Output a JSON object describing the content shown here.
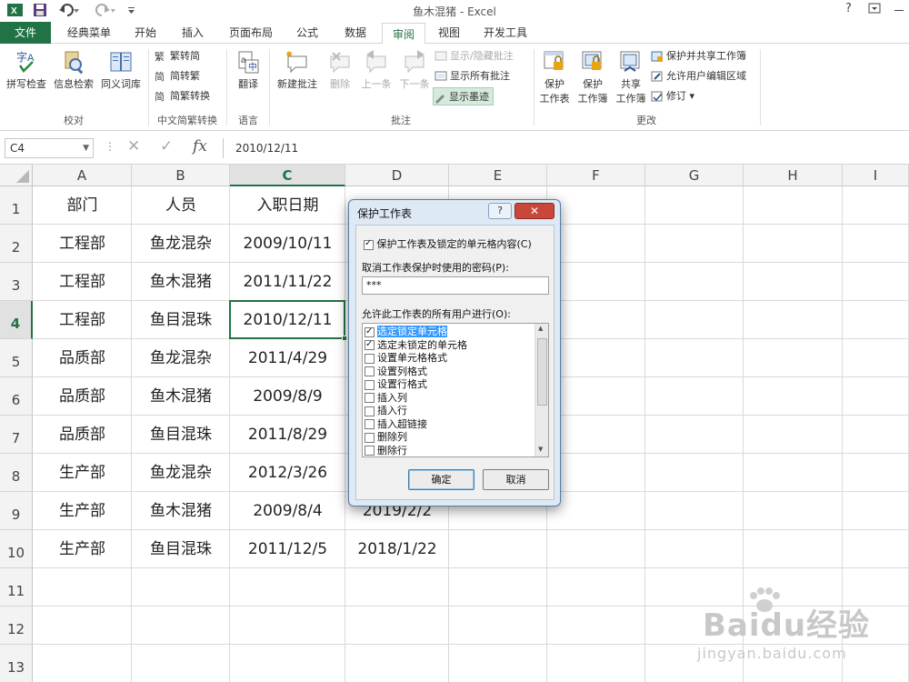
{
  "titlebar": {
    "title": "鱼木混猪 - Excel",
    "qa_icons": [
      "excel-logo-icon",
      "save-icon",
      "undo-icon",
      "redo-icon",
      "customize-icon"
    ],
    "win_icons": [
      "help-icon",
      "ribbon-display-icon",
      "minimize-icon"
    ]
  },
  "tabs": [
    "文件",
    "经典菜单",
    "开始",
    "插入",
    "页面布局",
    "公式",
    "数据",
    "审阅",
    "视图",
    "开发工具"
  ],
  "active_tab": "审阅",
  "ribbon": {
    "proofing": {
      "spell": "拼写检查",
      "research": "信息检索",
      "thesaurus": "同义词库",
      "label": "校对"
    },
    "chinese": {
      "t2s": "繁转简",
      "s2t": "简转繁",
      "convert": "简繁转换",
      "label": "中文简繁转换"
    },
    "language": {
      "translate": "翻译",
      "label": "语言"
    },
    "comments": {
      "new": "新建批注",
      "delete": "删除",
      "prev": "上一条",
      "next": "下一条",
      "show_hide": "显示/隐藏批注",
      "show_all": "显示所有批注",
      "show_ink": "显示墨迹",
      "label": "批注"
    },
    "changes": {
      "protect_sheet_1": "保护",
      "protect_sheet_2": "工作表",
      "protect_book_1": "保护",
      "protect_book_2": "工作簿",
      "share_1": "共享",
      "share_2": "工作簿",
      "protect_share": "保护并共享工作簿",
      "allow_edit": "允许用户编辑区域",
      "track": "修订",
      "label": "更改"
    }
  },
  "formula_bar": {
    "name_box": "C4",
    "formula": "2010/12/11",
    "fx": "fx"
  },
  "columns": [
    "A",
    "B",
    "C",
    "D",
    "E",
    "F",
    "G",
    "H",
    "I"
  ],
  "selected_column": "C",
  "rows": [
    "1",
    "2",
    "3",
    "4",
    "5",
    "6",
    "7",
    "8",
    "9",
    "10",
    "11",
    "12",
    "13"
  ],
  "selected_row": "4",
  "cells": {
    "header": [
      "部门",
      "人员",
      "入职日期"
    ],
    "data": [
      [
        "工程部",
        "鱼龙混杂",
        "2009/10/11"
      ],
      [
        "工程部",
        "鱼木混猪",
        "2011/11/22"
      ],
      [
        "工程部",
        "鱼目混珠",
        "2010/12/11"
      ],
      [
        "品质部",
        "鱼龙混杂",
        "2011/4/29"
      ],
      [
        "品质部",
        "鱼木混猪",
        "2009/8/9"
      ],
      [
        "品质部",
        "鱼目混珠",
        "2011/8/29"
      ],
      [
        "生产部",
        "鱼龙混杂",
        "2012/3/26"
      ],
      [
        "生产部",
        "鱼木混猪",
        "2009/8/4"
      ],
      [
        "生产部",
        "鱼目混珠",
        "2011/12/5"
      ]
    ],
    "d_visible": [
      "2019/2/2",
      "2018/1/22"
    ]
  },
  "dialog": {
    "title": "保护工作表",
    "help": "?",
    "close": "✕",
    "protect_checkbox": "保护工作表及锁定的单元格内容(C)",
    "password_label": "取消工作表保护时使用的密码(P):",
    "password_value": "***",
    "allow_label": "允许此工作表的所有用户进行(O):",
    "permissions": [
      {
        "label": "选定锁定单元格",
        "checked": true
      },
      {
        "label": "选定未锁定的单元格",
        "checked": true
      },
      {
        "label": "设置单元格格式",
        "checked": false
      },
      {
        "label": "设置列格式",
        "checked": false
      },
      {
        "label": "设置行格式",
        "checked": false
      },
      {
        "label": "插入列",
        "checked": false
      },
      {
        "label": "插入行",
        "checked": false
      },
      {
        "label": "插入超链接",
        "checked": false
      },
      {
        "label": "删除列",
        "checked": false
      },
      {
        "label": "删除行",
        "checked": false
      }
    ],
    "ok": "确定",
    "cancel": "取消"
  },
  "watermark": {
    "text": "Baidu经验",
    "sub": "jingyan.baidu.com"
  },
  "colors": {
    "excel_green": "#217346",
    "dialog_frame": "#dde9f5",
    "close_red": "#c9473a",
    "selection_blue": "#3399ff"
  }
}
